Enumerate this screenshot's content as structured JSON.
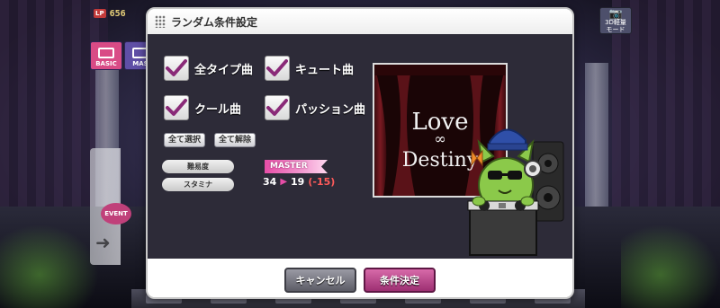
{
  "hud": {
    "lp_tag": "LP",
    "lp_value": "656",
    "tab_basic": "BASIC",
    "tab_mas": "MAS",
    "mode_button": "3D軽量\nモード",
    "event_badge": "EVENT"
  },
  "dialog": {
    "title": "ランダム条件設定",
    "checkboxes": [
      {
        "label": "全タイプ曲",
        "checked": true
      },
      {
        "label": "キュート曲",
        "checked": true
      },
      {
        "label": "クール曲",
        "checked": true
      },
      {
        "label": "パッション曲",
        "checked": true
      }
    ],
    "select_all": "全て選択",
    "deselect_all": "全て解除",
    "difficulty_label": "難易度",
    "difficulty_value": "MASTER",
    "stamina_label": "スタミナ",
    "stamina_from": "34",
    "stamina_to": "19",
    "stamina_delta": "(-15)",
    "jacket_text_1": "Love",
    "jacket_text_2": "Destiny",
    "cancel_button": "キャンセル",
    "confirm_button": "条件決定"
  },
  "colors": {
    "check_mark": "#8a2a78",
    "accent_pink": "#e64da6"
  }
}
